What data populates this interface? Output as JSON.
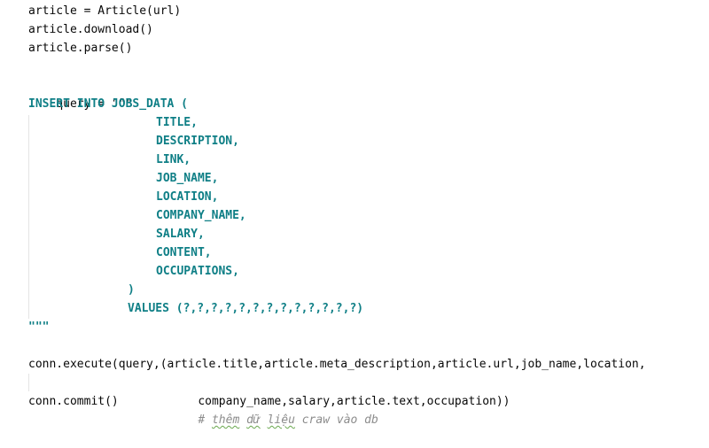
{
  "editor": {
    "lines": [
      {
        "text": "article = Article(url)"
      },
      {
        "text": "article.download()"
      },
      {
        "text": "article.parse()"
      },
      {
        "text": ""
      },
      {
        "text": "query = \"\"\""
      },
      {
        "text": "INSERT INTO JOBS_DATA ("
      },
      {
        "text": "TITLE,"
      },
      {
        "text": "DESCRIPTION,"
      },
      {
        "text": "LINK,"
      },
      {
        "text": "JOB_NAME,"
      },
      {
        "text": "LOCATION,"
      },
      {
        "text": "COMPANY_NAME,"
      },
      {
        "text": "SALARY,"
      },
      {
        "text": "CONTENT,"
      },
      {
        "text": "OCCUPATIONS,"
      },
      {
        "text": ")"
      },
      {
        "text": "VALUES (?,?,?,?,?,?,?,?,?,?,?,?,?)"
      },
      {
        "text": "\"\"\""
      },
      {
        "text": ""
      },
      {
        "text": "conn.execute(query,(article.title,article.meta_description,article.url,job_name,location,"
      },
      {
        "text": "company_name,salary,article.text,occupation))"
      },
      {
        "text": "conn.commit()"
      }
    ],
    "comment": {
      "prefix": "# ",
      "word1": "thêm",
      "word2": "dữ",
      "word3": "liệu",
      "rest": " craw vào db"
    }
  }
}
